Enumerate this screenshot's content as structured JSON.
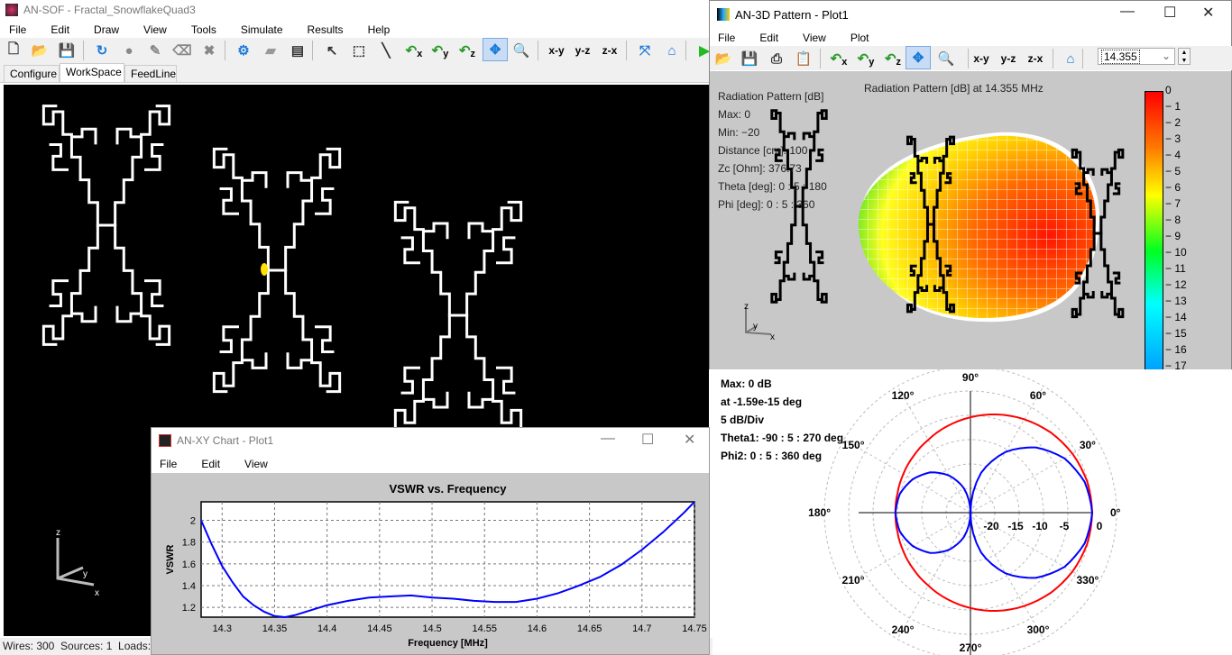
{
  "main_window": {
    "title": "AN-SOF - Fractal_SnowflakeQuad3",
    "menu": [
      "File",
      "Edit",
      "Draw",
      "View",
      "Tools",
      "Simulate",
      "Results",
      "Help"
    ],
    "toolbar": [
      {
        "icon": "new-file-icon"
      },
      {
        "icon": "open-folder-icon"
      },
      {
        "icon": "save-icon"
      },
      {
        "icon": "rotate-icon"
      },
      {
        "icon": "circle-icon"
      },
      {
        "icon": "pencil-icon"
      },
      {
        "icon": "eraser-icon"
      },
      {
        "icon": "delete-icon"
      },
      {
        "icon": "settings-gear-icon"
      },
      {
        "icon": "comment-icon"
      },
      {
        "icon": "report-icon"
      },
      {
        "icon": "pointer-icon"
      },
      {
        "icon": "select-rectangle-icon"
      },
      {
        "icon": "line-icon"
      },
      {
        "icon": "rotate-x-icon",
        "label": "x"
      },
      {
        "icon": "rotate-y-icon",
        "label": "y"
      },
      {
        "icon": "rotate-z-icon",
        "label": "z"
      },
      {
        "icon": "pan-icon",
        "active": true
      },
      {
        "icon": "zoom-icon"
      },
      {
        "icon": "view-xy-icon",
        "label": "x-y"
      },
      {
        "icon": "view-yz-icon",
        "label": "y-z"
      },
      {
        "icon": "view-zx-icon",
        "label": "z-x"
      },
      {
        "icon": "fit-icon"
      },
      {
        "icon": "home-icon"
      },
      {
        "icon": "run-icon"
      }
    ],
    "tabs": [
      {
        "label": "Configure"
      },
      {
        "label": "WorkSpace",
        "active": true
      },
      {
        "label": "FeedLine"
      }
    ],
    "axes": {
      "x": "x",
      "y": "y",
      "z": "z"
    },
    "status": "Wires: 300  Sources: 1  Loads: 0"
  },
  "pattern_window": {
    "title": "AN-3D Pattern - Plot1",
    "menu": [
      "File",
      "Edit",
      "View",
      "Plot"
    ],
    "toolbar": [
      {
        "icon": "open-folder-icon"
      },
      {
        "icon": "save-icon"
      },
      {
        "icon": "print-icon"
      },
      {
        "icon": "clipboard-icon"
      },
      {
        "icon": "rotate-x-icon",
        "label": "x"
      },
      {
        "icon": "rotate-y-icon",
        "label": "y"
      },
      {
        "icon": "rotate-z-icon",
        "label": "z"
      },
      {
        "icon": "pan-icon",
        "active": true
      },
      {
        "icon": "zoom-icon"
      },
      {
        "icon": "view-xy-icon",
        "label": "x-y"
      },
      {
        "icon": "view-yz-icon",
        "label": "y-z"
      },
      {
        "icon": "view-zx-icon",
        "label": "z-x"
      },
      {
        "icon": "home-icon"
      }
    ],
    "frequency_select": "14.355",
    "plot_title": "Radiation Pattern [dB] at 14.355 MHz",
    "info": [
      "Radiation Pattern [dB]",
      "Max: 0",
      "Min: −20",
      "Distance [cm]: 100",
      "Zc [Ohm]: 376.73",
      "Theta [deg]: 0 : 5 : 180",
      "Phi [deg]: 0 : 5 : 360"
    ],
    "colorbar_ticks": [
      "0",
      "− 1",
      "− 2",
      "− 3",
      "− 4",
      "− 5",
      "− 6",
      "− 7",
      "− 8",
      "− 9",
      "− 10",
      "− 11",
      "− 12",
      "− 13",
      "− 14",
      "− 15",
      "− 16",
      "− 17"
    ],
    "axes": {
      "x": "x",
      "y": "y",
      "z": "z"
    }
  },
  "polar_panel": {
    "info": [
      "Max: 0 dB",
      "at -1.59e-15 deg",
      "5 dB/Div",
      "Theta1: -90 : 5 : 270 deg",
      "Phi2: 0 : 5 : 360 deg"
    ]
  },
  "xy_window": {
    "title": "AN-XY Chart - Plot1",
    "menu": [
      "File",
      "Edit",
      "View"
    ]
  },
  "chart_data": [
    {
      "type": "line",
      "title": "VSWR vs. Frequency",
      "xlabel": "Frequency [MHz]",
      "ylabel": "VSWR",
      "xlim": [
        14.28,
        14.75
      ],
      "ylim": [
        1.11,
        2.17
      ],
      "grid": true,
      "xticks": [
        "14.3",
        "14.35",
        "14.4",
        "14.45",
        "14.5",
        "14.55",
        "14.6",
        "14.65",
        "14.7",
        "14.75"
      ],
      "yticks": [
        "1.2",
        "1.4",
        "1.6",
        "1.8",
        "2"
      ],
      "color": "#0000ff",
      "x": [
        14.28,
        14.29,
        14.3,
        14.31,
        14.32,
        14.33,
        14.34,
        14.35,
        14.36,
        14.37,
        14.38,
        14.39,
        14.4,
        14.42,
        14.44,
        14.46,
        14.48,
        14.5,
        14.52,
        14.54,
        14.56,
        14.58,
        14.6,
        14.62,
        14.64,
        14.66,
        14.68,
        14.7,
        14.72,
        14.74,
        14.75
      ],
      "y": [
        2.0,
        1.78,
        1.58,
        1.43,
        1.3,
        1.22,
        1.16,
        1.12,
        1.11,
        1.13,
        1.16,
        1.19,
        1.22,
        1.26,
        1.29,
        1.3,
        1.31,
        1.29,
        1.28,
        1.26,
        1.25,
        1.25,
        1.28,
        1.33,
        1.4,
        1.48,
        1.59,
        1.73,
        1.89,
        2.07,
        2.17
      ]
    },
    {
      "type": "polar",
      "radial_range_db": [
        -25,
        0
      ],
      "radial_ticks": [
        "-20",
        "-15",
        "-10",
        "-5",
        "0"
      ],
      "angle_ticks": [
        "0°",
        "30°",
        "60°",
        "90°",
        "120°",
        "150°",
        "180°",
        "210°",
        "240°",
        "270°",
        "300°",
        "330°"
      ],
      "angles_deg": [
        0,
        15,
        30,
        45,
        60,
        75,
        90,
        105,
        120,
        135,
        150,
        165,
        180,
        195,
        210,
        225,
        240,
        255,
        270,
        285,
        300,
        315,
        330,
        345
      ],
      "series": [
        {
          "color": "#ff0000",
          "values_db": [
            0,
            -0.2,
            -0.8,
            -1.7,
            -2.85,
            -4.1,
            -5.4,
            -6.6,
            -7.7,
            -8.5,
            -9.1,
            -9.5,
            -9.6,
            -9.5,
            -9.1,
            -8.5,
            -7.7,
            -6.6,
            -5.4,
            -4.1,
            -2.85,
            -1.7,
            -0.8,
            -0.2
          ]
        },
        {
          "color": "#0000ff",
          "values_db": [
            0,
            -0.7,
            -2.7,
            -6.05,
            -10.6,
            -16.5,
            -25,
            -19.8,
            -16.2,
            -13.3,
            -11.3,
            -10.0,
            -9.6,
            -10.0,
            -11.3,
            -13.3,
            -16.2,
            -19.8,
            -25,
            -16.5,
            -10.6,
            -6.05,
            -2.7,
            -0.7
          ]
        }
      ]
    }
  ]
}
